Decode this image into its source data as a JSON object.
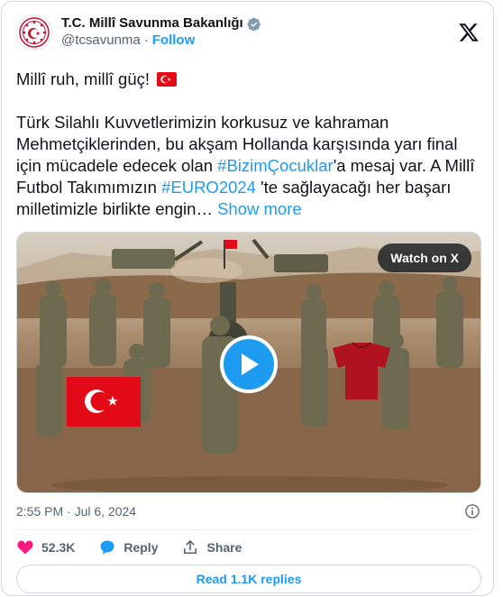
{
  "user": {
    "display_name": "T.C. Millî Savunma Bakanlığı",
    "handle": "@tcsavunma",
    "separator": "·",
    "follow_label": "Follow"
  },
  "tweet": {
    "line1": "Millî ruh, millî güç!",
    "part1": "Türk Silahlı Kuvvetlerimizin korkusuz ve kahraman Mehmetçiklerinden, bu akşam Hollanda karşısında yarı final için mücadele edecek olan ",
    "hashtag1": "#BizimÇocuklar",
    "part2": "'a mesaj var. A Millî Futbol Takımımızın ",
    "hashtag2": "#EURO2024",
    "part3": " 'te sağlayacağı her başarı milletimizle birlikte engin…",
    "show_more": "Show more"
  },
  "media": {
    "watch_label": "Watch on X"
  },
  "meta": {
    "timestamp": "2:55 PM · Jul 6, 2024"
  },
  "actions": {
    "likes": "52.3K",
    "reply_label": "Reply",
    "share_label": "Share"
  },
  "replies_button": "Read 1.1K replies",
  "colors": {
    "accent": "#1d9bf0",
    "like": "#f91880",
    "text": "#0f1419",
    "muted": "#536471",
    "flag_red": "#e30a17"
  }
}
